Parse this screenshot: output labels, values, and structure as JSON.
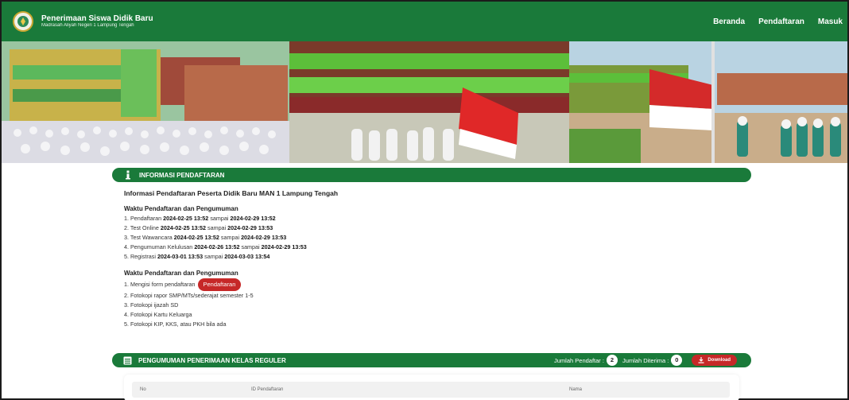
{
  "navbar": {
    "title": "Penerimaan Siswa Didik Baru",
    "subtitle": "Madrasah Aliyah Negeri 1 Lampung Tengah",
    "links": [
      "Beranda",
      "Pendaftaran",
      "Masuk"
    ]
  },
  "info": {
    "section_title": "INFORMASI PENDAFTARAN",
    "heading": "Informasi Pendaftaran Peserta Didik Baru MAN 1 Lampung Tengah",
    "schedule_title": "Waktu Pendaftaran dan Pengumuman",
    "schedule": [
      {
        "label": "1. Pendaftaran",
        "start": "2024-02-25 13:52",
        "end": "2024-02-29 13:52"
      },
      {
        "label": "2. Test Online",
        "start": "2024-02-25 13:52",
        "end": "2024-02-29 13:53"
      },
      {
        "label": "3. Test Wawancara",
        "start": "2024-02-25 13:52",
        "end": "2024-02-29 13:53"
      },
      {
        "label": "4. Pengumuman Kelulusan",
        "start": "2024-02-26 13:52",
        "end": "2024-02-29 13:53"
      },
      {
        "label": "5. Registrasi",
        "start": "2024-03-01 13:53",
        "end": "2024-03-03 13:54"
      }
    ],
    "between_word": "sampai",
    "requirements_title": "Waktu Pendaftaran dan Pengumuman",
    "requirements": [
      "1. Mengisi form pendaftaran",
      "2. Fotokopi rapor SMP/MTs/sederajat semester 1-5",
      "3. Fotokopi ijazah SD",
      "4. Fotokopi Kartu Keluarga",
      "5. Fotokopi KIP, KKS, atau PKH bila ada"
    ],
    "register_button": "Pendaftaran"
  },
  "announcement": {
    "section_title": "PENGUMUMAN PENERIMAAN KELAS REGULER",
    "registrants_label": "Jumlah Pendaftar :",
    "registrants_count": "2",
    "accepted_label": "Jumlah Diterima :",
    "accepted_count": "0",
    "download_label": "Download",
    "columns": [
      "No",
      "ID Pendaftaran",
      "Nama"
    ]
  },
  "colors": {
    "primary_green": "#1a7a3a",
    "accent_red": "#c62828"
  }
}
